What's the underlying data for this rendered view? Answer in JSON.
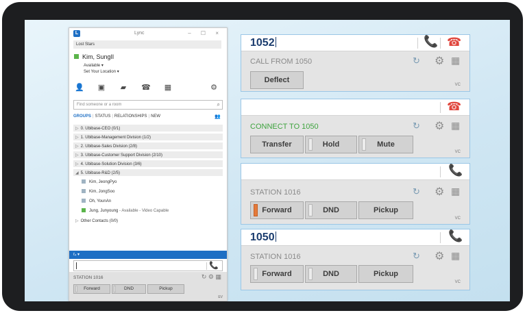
{
  "lync": {
    "title": "Lync",
    "window_controls": "– ☐ ×",
    "note": "Lost Stars",
    "me": {
      "name": "Kim, SungIl",
      "status": "Available ▾",
      "location": "Set Your Location ▾"
    },
    "search_placeholder": "Find someone or a room",
    "tabs": {
      "groups": "GROUPS",
      "status": "STATUS",
      "relationships": "RELATIONSHIPS",
      "new": "NEW"
    },
    "groups": [
      {
        "arrow": "▷",
        "label": "0. Ubibase-CEO (0/1)"
      },
      {
        "arrow": "▷",
        "label": "1. Ubibase-Management Division (1/2)"
      },
      {
        "arrow": "▷",
        "label": "2. Ubibase-Sales Division (2/8)"
      },
      {
        "arrow": "▷",
        "label": "3. Ubibase-Customer Support Division (2/10)"
      },
      {
        "arrow": "▷",
        "label": "4. Ubibase-Solution Division  (3/6)"
      },
      {
        "arrow": "◢",
        "label": "5. Ubibase-R&D (2/5)"
      }
    ],
    "members": [
      {
        "name": "Kim, JeongPyo",
        "extra": ""
      },
      {
        "name": "Kim, JongSoo",
        "extra": ""
      },
      {
        "name": "Oh, YounAn",
        "extra": ""
      },
      {
        "name": "Jung, Junyoung",
        "extra": "- Available - Video Capable"
      }
    ],
    "other_contacts": {
      "arrow": "▷",
      "label": "Other Contacts (0/0)"
    },
    "bar_label": "&#8467;ₔ ▾",
    "mini": {
      "station": "STATION 1016",
      "forward": "Forward",
      "dnd": "DND",
      "pickup": "Pickup",
      "ev": "EV"
    }
  },
  "panels": [
    {
      "number": "1052",
      "status": "CALL FROM 1050",
      "buttons": [
        "Deflect"
      ],
      "vc": "VC"
    },
    {
      "number": "",
      "status": "CONNECT TO 1050",
      "buttons": [
        "Transfer",
        "Hold",
        "Mute"
      ],
      "vc": "VC"
    },
    {
      "number": "",
      "status": "STATION 1016",
      "buttons": [
        "Forward",
        "DND",
        "Pickup"
      ],
      "vc": "VC"
    },
    {
      "number": "1050",
      "status": "STATION 1016",
      "buttons": [
        "Forward",
        "DND",
        "Pickup"
      ],
      "vc": "VC"
    }
  ],
  "colors": {
    "brand_blue": "#1e6fc4",
    "call_green": "#48a848",
    "hangup_red": "#e0463d",
    "forward_active": "#e47a3b"
  }
}
